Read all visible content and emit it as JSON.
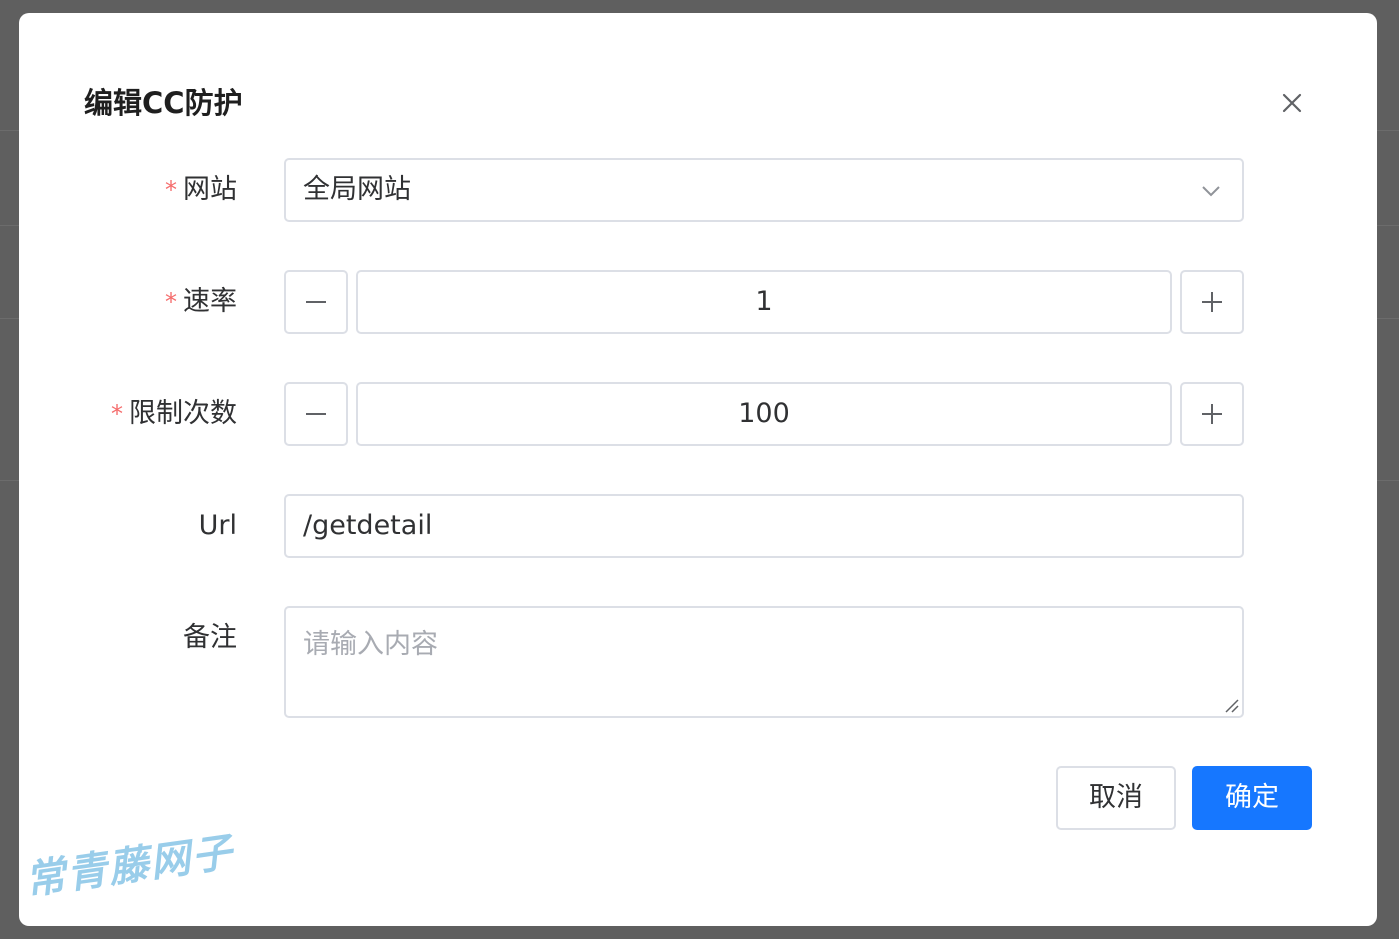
{
  "dialog": {
    "title": "编辑CC防护",
    "close_icon": "close-icon"
  },
  "form": {
    "website": {
      "label": "网站",
      "required": true,
      "value": "全局网站"
    },
    "rate": {
      "label": "速率",
      "required": true,
      "value": "1",
      "minus": "−",
      "plus": "+"
    },
    "limit": {
      "label": "限制次数",
      "required": true,
      "value": "100",
      "minus": "−",
      "plus": "+"
    },
    "url": {
      "label": "Url",
      "value": "/getdetail"
    },
    "note": {
      "label": "备注",
      "placeholder": "请输入内容"
    },
    "required_mark": "*"
  },
  "footer": {
    "cancel_label": "取消",
    "confirm_label": "确定"
  },
  "watermark": "常青藤网子",
  "colors": {
    "primary": "#1677ff",
    "required": "#f56c6c",
    "border": "#dcdfe6"
  }
}
